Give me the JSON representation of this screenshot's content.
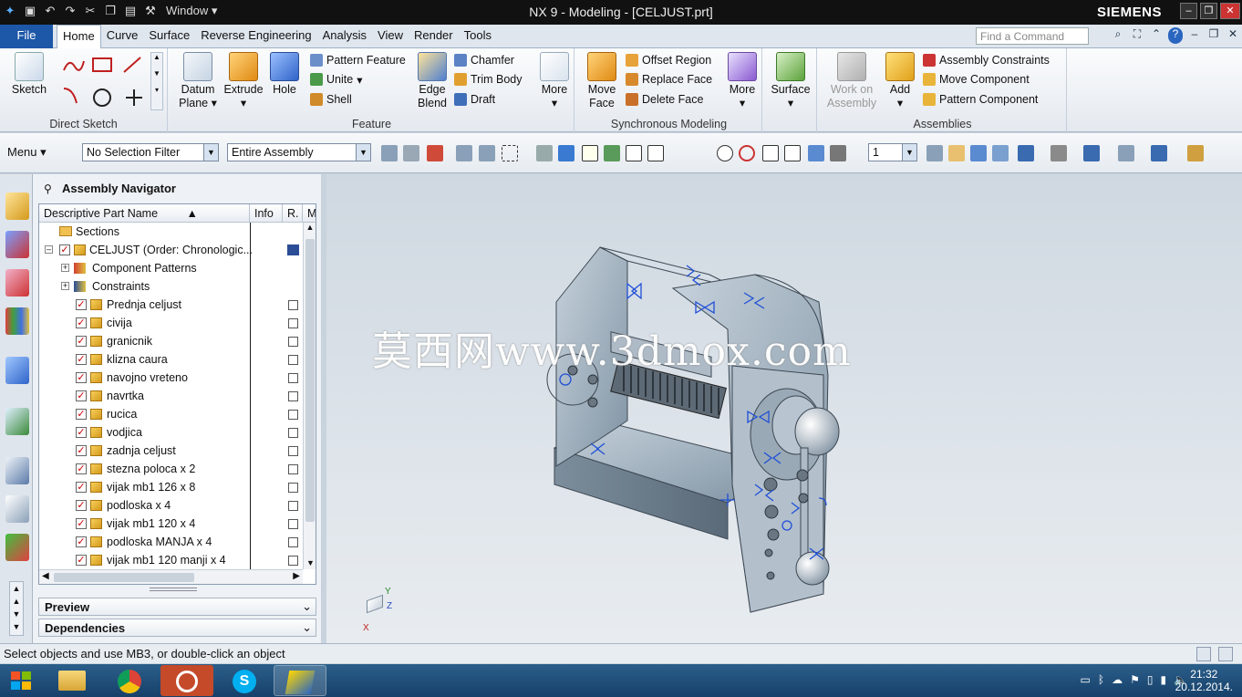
{
  "titlebar": {
    "window_menu": "Window ▾",
    "title": "NX 9 - Modeling - [CELJUST.prt]",
    "brand": "SIEMENS"
  },
  "tabs": {
    "file": "File",
    "items": [
      "Home",
      "Curve",
      "Surface",
      "Reverse Engineering",
      "Analysis",
      "View",
      "Render",
      "Tools"
    ],
    "active": "Home",
    "find_placeholder": "Find a Command"
  },
  "ribbon": {
    "direct_sketch": {
      "label": "Direct Sketch",
      "sketch": "Sketch"
    },
    "feature": {
      "label": "Feature",
      "datum": "Datum",
      "plane": "Plane",
      "extrude": "Extrude",
      "hole": "Hole",
      "pattern_feature": "Pattern Feature",
      "unite": "Unite",
      "shell": "Shell",
      "edge": "Edge",
      "blend": "Blend",
      "chamfer": "Chamfer",
      "trim_body": "Trim Body",
      "draft": "Draft",
      "more": "More"
    },
    "sync": {
      "label": "Synchronous Modeling",
      "move": "Move",
      "face": "Face",
      "offset_region": "Offset Region",
      "replace_face": "Replace Face",
      "delete_face": "Delete Face",
      "more": "More"
    },
    "surface": {
      "label": "Surface"
    },
    "assemblies": {
      "label": "Assemblies",
      "work_on": "Work on",
      "assembly": "Assembly",
      "add": "Add",
      "assembly_constraints": "Assembly Constraints",
      "move_component": "Move Component",
      "pattern_component": "Pattern Component"
    }
  },
  "selbar": {
    "menu": "Menu ▾",
    "filter": "No Selection Filter",
    "scope": "Entire Assembly",
    "layer": "1"
  },
  "navigator": {
    "title": "Assembly Navigator",
    "columns": [
      "Descriptive Part Name",
      "Info",
      "R.",
      "M"
    ],
    "sections": "Sections",
    "root": "CELJUST (Order: Chronologic...",
    "component_patterns": "Component Patterns",
    "constraints": "Constraints",
    "parts": [
      "Prednja celjust",
      "civija",
      "granicnik",
      "klizna caura",
      "navojno vreteno",
      "navrtka",
      "rucica",
      "vodjica",
      "zadnja celjust",
      "stezna poloca x 2",
      "vijak mb1 126 x 8",
      "podloska x 4",
      "vijak mb1 120 x 4",
      "podloska MANJA x 4",
      "vijak mb1 120 manji x 4"
    ],
    "preview": "Preview",
    "dependencies": "Dependencies"
  },
  "viewport": {
    "watermark": "莫西网www.3dmox.com",
    "axis_x": "X",
    "axis_y": "Y",
    "axis_z": "Z"
  },
  "status": {
    "message": "Select objects and use MB3, or double-click an object"
  },
  "taskbar": {
    "time": "21:32",
    "date": "20.12.2014."
  },
  "colors": {
    "file_tab": "#1c57a8",
    "titlebar": "#111111",
    "model_gray": "#a4b4c2",
    "constraint_blue": "#1f4fd6"
  }
}
